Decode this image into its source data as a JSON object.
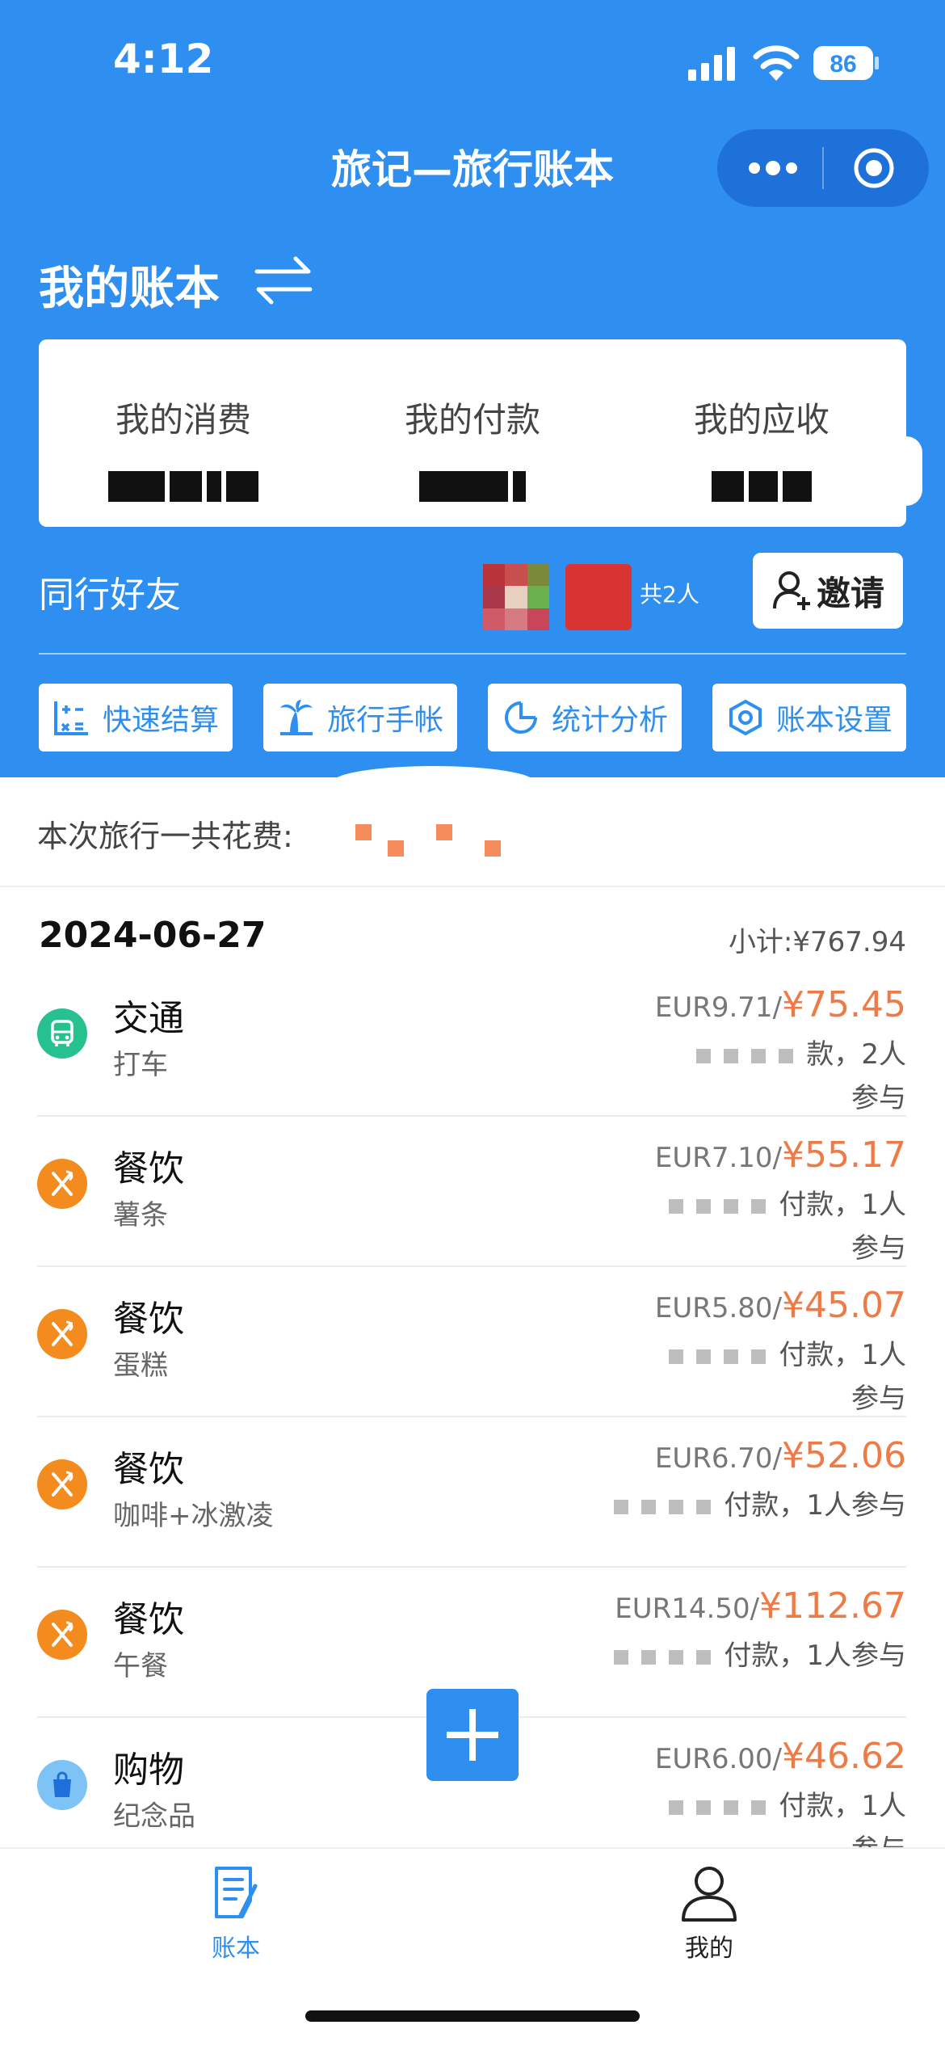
{
  "status": {
    "time": "4:12",
    "battery": "86"
  },
  "nav": {
    "title": "旅记—旅行账本"
  },
  "ledger": {
    "title": "我的账本"
  },
  "summary": {
    "consume_label": "我的消费",
    "paid_label": "我的付款",
    "receivable_label": "我的应收"
  },
  "friends": {
    "label": "同行好友",
    "count": "共2人",
    "invite_label": "邀请"
  },
  "actions": [
    {
      "label": "快速结算",
      "icon": "calculator-icon"
    },
    {
      "label": "旅行手帐",
      "icon": "palm-tree-icon"
    },
    {
      "label": "统计分析",
      "icon": "pie-chart-icon"
    },
    {
      "label": "账本设置",
      "icon": "hexagon-settings-icon"
    }
  ],
  "trip_total_label": "本次旅行一共花费:",
  "day": {
    "date": "2024-06-27",
    "subtotal": "小计:¥767.94"
  },
  "transactions": [
    {
      "category": "交通",
      "note": "打车",
      "eur": "EUR9.71",
      "cny": "¥75.45",
      "pay_tail": "款，2人",
      "pay_tail2": "参与",
      "icon": "bus-icon",
      "color": "#27c08f"
    },
    {
      "category": "餐饮",
      "note": "薯条",
      "eur": "EUR7.10",
      "cny": "¥55.17",
      "pay_tail": "付款，1人",
      "pay_tail2": "参与",
      "icon": "utensils-icon",
      "color": "#f48b1e"
    },
    {
      "category": "餐饮",
      "note": "蛋糕",
      "eur": "EUR5.80",
      "cny": "¥45.07",
      "pay_tail": "付款，1人",
      "pay_tail2": "参与",
      "icon": "utensils-icon",
      "color": "#f48b1e"
    },
    {
      "category": "餐饮",
      "note": "咖啡+冰激凌",
      "eur": "EUR6.70",
      "cny": "¥52.06",
      "pay_tail": "付款，1人参与",
      "pay_tail2": "",
      "icon": "utensils-icon",
      "color": "#f48b1e"
    },
    {
      "category": "餐饮",
      "note": "午餐",
      "eur": "EUR14.50",
      "cny": "¥112.67",
      "pay_tail": "付款，1人参与",
      "pay_tail2": "",
      "icon": "utensils-icon",
      "color": "#f48b1e"
    },
    {
      "category": "购物",
      "note": "纪念品",
      "eur": "EUR6.00",
      "cny": "¥46.62",
      "pay_tail": "付款，1人",
      "pay_tail2": "参与",
      "icon": "shopping-bag-icon",
      "color": "#7ec3f5"
    }
  ],
  "tabs": {
    "ledger": "账本",
    "mine": "我的"
  },
  "colors": {
    "primary": "#2e8ff0",
    "accent_orange": "#ee7a45"
  }
}
